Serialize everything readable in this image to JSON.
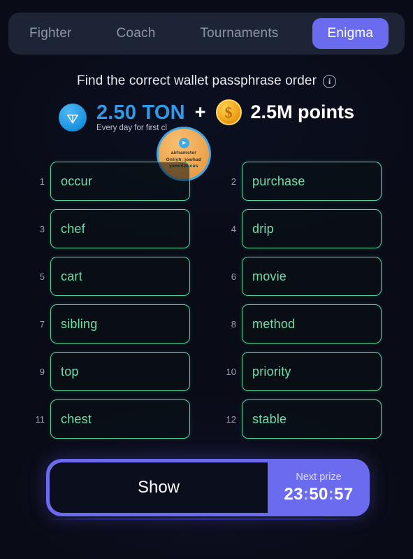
{
  "tabs": [
    {
      "label": "Fighter",
      "active": false
    },
    {
      "label": "Coach",
      "active": false
    },
    {
      "label": "Tournaments",
      "active": false
    },
    {
      "label": "Enigma",
      "active": true
    }
  ],
  "header": {
    "title": "Find the correct wallet passphrase order",
    "info_icon": "info-icon"
  },
  "prize": {
    "ton_icon": "ton-logo-icon",
    "ton_amount": "2.50 TON",
    "ton_subtitle": "Every day for first cl",
    "plus": "+",
    "coin_icon": "coin-icon",
    "coin_symbol": "$",
    "points": "2.5M points"
  },
  "badge": {
    "telegram_icon": "telegram-icon",
    "line1": "airhamster",
    "line2": "Onliyh: jowhad",
    "line3": "yansSjtucus"
  },
  "words": [
    {
      "num": "1",
      "word": "occur"
    },
    {
      "num": "2",
      "word": "purchase"
    },
    {
      "num": "3",
      "word": "chef"
    },
    {
      "num": "4",
      "word": "drip"
    },
    {
      "num": "5",
      "word": "cart"
    },
    {
      "num": "6",
      "word": "movie"
    },
    {
      "num": "7",
      "word": "sibling"
    },
    {
      "num": "8",
      "word": "method"
    },
    {
      "num": "9",
      "word": "top"
    },
    {
      "num": "10",
      "word": "priority"
    },
    {
      "num": "11",
      "word": "chest"
    },
    {
      "num": "12",
      "word": "stable"
    }
  ],
  "bottom": {
    "show_label": "Show",
    "next_prize_label": "Next prize",
    "timer_hours": "23",
    "timer_minutes": "50",
    "timer_seconds": "57",
    "timer_sep": ":"
  },
  "colors": {
    "background": "#090b16",
    "tabbar": "#1d2435",
    "accent_purple": "#6b6bf0",
    "accent_green": "#55d69b",
    "word_text": "#6fe0ac",
    "ton_blue": "#2f9ae8",
    "coin_gold": "#f0a018",
    "badge_orange": "#eda04a",
    "muted_text": "#8d95a8"
  }
}
